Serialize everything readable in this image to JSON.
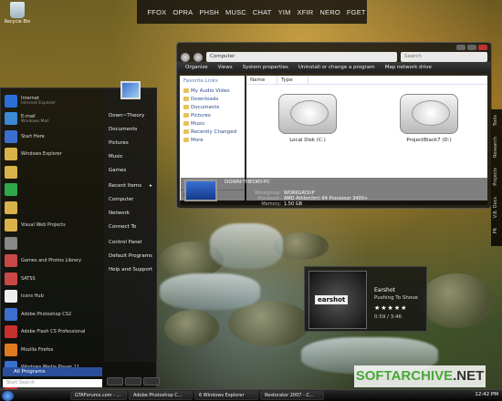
{
  "quicklaunch": [
    "FFOX",
    "OPRA",
    "PHSH",
    "MUSC",
    "CHAT",
    "YIM",
    "XFIR",
    "NERO",
    "FGET"
  ],
  "desktop": {
    "recycle_bin": "Recycle Bin"
  },
  "explorer": {
    "address": "Computer",
    "search_placeholder": "Search",
    "toolbar": [
      "Organize",
      "Views",
      "System properties",
      "Uninstall or change a program",
      "Map network drive"
    ],
    "favorite_links_header": "Favorite Links",
    "favorite_links": [
      "My Audio Video",
      "Downloads",
      "Documents",
      "Pictures",
      "Music",
      "Recently Changed",
      "More"
    ],
    "folders_label": "Folders",
    "columns": [
      "Name",
      "Type"
    ],
    "drives": [
      {
        "label": "Local Disk (C:)"
      },
      {
        "label": "ProjectBlack7 (D:)"
      }
    ],
    "details": {
      "computer_name": "DOWN-THEORY-PC",
      "rows": [
        {
          "k": "Workgroup:",
          "v": "WORKGROUP"
        },
        {
          "k": "Processor:",
          "v": "AMD Athlon(tm) 64 Processor 3400+"
        },
        {
          "k": "Memory:",
          "v": "1.50 GB"
        }
      ]
    }
  },
  "start_menu": {
    "pinned": [
      {
        "label": "Internet",
        "sub": "Internet Explorer",
        "color": "#2a6fd6"
      },
      {
        "label": "E-mail",
        "sub": "Windows Mail",
        "color": "#3a8ad6"
      },
      {
        "label": "Start Here",
        "sub": "",
        "color": "#3a6fd0"
      },
      {
        "label": "Windows Explorer",
        "sub": "",
        "color": "#d9b24a"
      },
      {
        "label": "",
        "sub": "",
        "color": "#d9b24a"
      },
      {
        "label": "",
        "sub": "",
        "color": "#2fa84a"
      },
      {
        "label": "",
        "sub": "",
        "color": "#d9b24a"
      },
      {
        "label": "Visual Web Projects",
        "sub": "",
        "color": "#d9b24a"
      },
      {
        "label": "",
        "sub": "",
        "color": "#888888"
      },
      {
        "label": "Games and Photos Library",
        "sub": "",
        "color": "#c84848"
      },
      {
        "label": "SATSS",
        "sub": "",
        "color": "#c84848"
      },
      {
        "label": "Icons Hub",
        "sub": "",
        "color": "#eeeeee"
      },
      {
        "label": "Adobe Photoshop CS2",
        "sub": "",
        "color": "#3a6fd0"
      },
      {
        "label": "Adobe Flash CS Professional",
        "sub": "",
        "color": "#c83030"
      },
      {
        "label": "Mozilla Firefox",
        "sub": "",
        "color": "#e07a20"
      },
      {
        "label": "Windows Media Player 11",
        "sub": "",
        "color": "#3a6fd0"
      },
      {
        "label": "Reference Website",
        "sub": "",
        "color": "#c83030"
      }
    ],
    "right": [
      "Down~Theory",
      "Documents",
      "Pictures",
      "Music",
      "Games",
      "Recent Items",
      "Computer",
      "Network",
      "Connect To",
      "Control Panel",
      "Default Programs",
      "Help and Support"
    ],
    "all_programs": "All Programs",
    "search_placeholder": "Start Search"
  },
  "side_tabs": [
    "Tools",
    "Research",
    "Projects",
    "V.B. Docs",
    "PR"
  ],
  "media": {
    "art_text": "earshot",
    "title": "Earshot",
    "subtitle": "Pushing To Shove",
    "stars": "★★★★★",
    "time": "0:59 / 3:46"
  },
  "watermark": {
    "brand": "SOFTARCHIVE",
    "suffix": ".NET"
  },
  "taskbar": {
    "tasks": [
      "GTAForums.com - ...",
      "Adobe Photoshop C...",
      "6 Windows Explorer",
      "Restorator 2007 - C..."
    ],
    "clock": "12:42 PM"
  }
}
